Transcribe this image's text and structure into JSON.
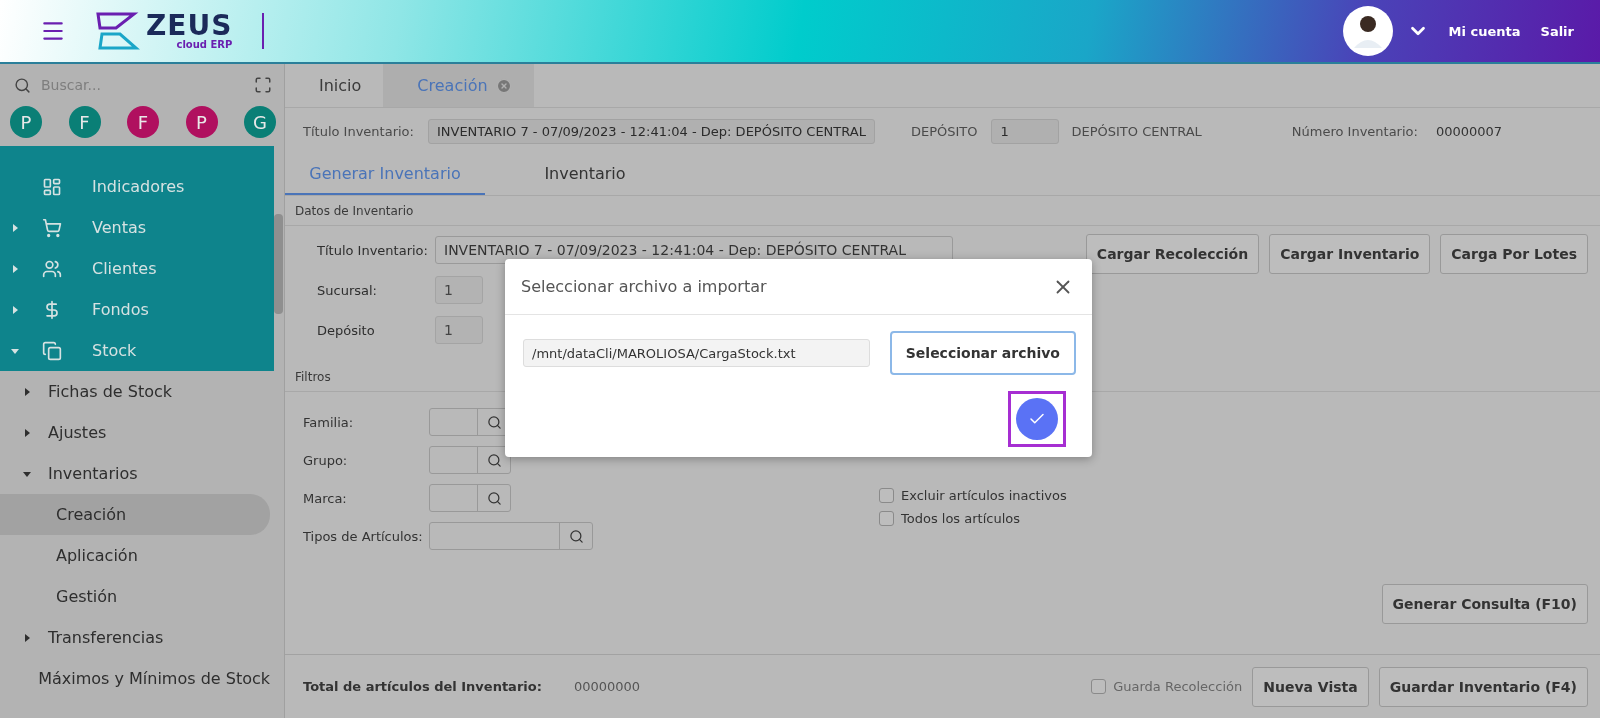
{
  "header": {
    "logo": {
      "name": "ZEUS",
      "tagline": "cloud ERP"
    },
    "account_link": "Mi cuenta",
    "logout_link": "Salir"
  },
  "sidebar": {
    "search": {
      "placeholder": "Buscar..."
    },
    "shortcuts": [
      {
        "letter": "P",
        "color": "#0a7f76"
      },
      {
        "letter": "F",
        "color": "#0a7f76"
      },
      {
        "letter": "F",
        "color": "#b0105f"
      },
      {
        "letter": "P",
        "color": "#b0105f"
      },
      {
        "letter": "G",
        "color": "#0a7f76"
      }
    ],
    "modules": [
      {
        "label": "Indicadores",
        "kind": "link"
      },
      {
        "label": "Ventas",
        "kind": "group",
        "expanded": false
      },
      {
        "label": "Clientes",
        "kind": "group",
        "expanded": false
      },
      {
        "label": "Fondos",
        "kind": "group",
        "expanded": false
      },
      {
        "label": "Stock",
        "kind": "group",
        "expanded": true
      }
    ],
    "items": [
      {
        "label": "Fichas de Stock",
        "kind": "group",
        "expanded": false
      },
      {
        "label": "Ajustes",
        "kind": "group",
        "expanded": false
      },
      {
        "label": "Inventarios",
        "kind": "group",
        "expanded": true,
        "children": [
          {
            "label": "Creación",
            "selected": true
          },
          {
            "label": "Aplicación",
            "selected": false
          },
          {
            "label": "Gestión",
            "selected": false
          }
        ]
      },
      {
        "label": "Transferencias",
        "kind": "group",
        "expanded": false
      },
      {
        "label": "Máximos y Mínimos de Stock",
        "kind": "link"
      }
    ]
  },
  "tabs": [
    {
      "label": "Inicio",
      "selected": false,
      "closable": false
    },
    {
      "label": "Creación",
      "selected": true,
      "closable": true
    }
  ],
  "info_bar": {
    "title_label": "Título Inventario:",
    "title_value": "INVENTARIO 7 - 07/09/2023 - 12:41:04 - Dep: DEPÓSITO CENTRAL",
    "deposit_label": "DEPÓSITO",
    "deposit_code": "1",
    "deposit_name": "DEPÓSITO CENTRAL",
    "number_label": "Número Inventario:",
    "number_value": "00000007"
  },
  "subtabs": [
    {
      "label": "Generar Inventario",
      "selected": true
    },
    {
      "label": "Inventario",
      "selected": false
    }
  ],
  "data_section": {
    "heading": "Datos de Inventario",
    "fields": [
      {
        "label": "Título Inventario:",
        "value": "INVENTARIO 7 - 07/09/2023 - 12:41:04 - Dep: DEPÓSITO CENTRAL",
        "kind": "text"
      },
      {
        "label": "Sucursal:",
        "value": "1",
        "kind": "lookup"
      },
      {
        "label": "Depósito",
        "value": "1",
        "kind": "lookup"
      }
    ],
    "buttons": [
      "Cargar Recolección",
      "Cargar Inventario",
      "Carga Por Lotes"
    ]
  },
  "filters": {
    "heading": "Filtros",
    "fields": [
      {
        "label": "Familia:",
        "wide": false
      },
      {
        "label": "Grupo:",
        "wide": false
      },
      {
        "label": "Marca:",
        "wide": false
      },
      {
        "label": "Tipos de Artículos:",
        "wide": true
      }
    ],
    "checkboxes": [
      {
        "label": "Excluir artículos inactivos",
        "checked": false
      },
      {
        "label": "Todos los artículos",
        "checked": false
      }
    ],
    "query_button": "Generar Consulta (F10)"
  },
  "footer": {
    "total_label": "Total de artículos del Inventario:",
    "total_value": "00000000",
    "checkbox": {
      "label": "Guarda Recolección",
      "checked": false
    },
    "buttons": [
      "Nueva Vista",
      "Guardar Inventario (F4)"
    ]
  },
  "dialog": {
    "title": "Seleccionar archivo a importar",
    "file_path": "/mnt/dataCli/MAROLIOSA/CargaStock.txt",
    "select_button": "Seleccionar archivo",
    "confirm_highlighted": true
  }
}
